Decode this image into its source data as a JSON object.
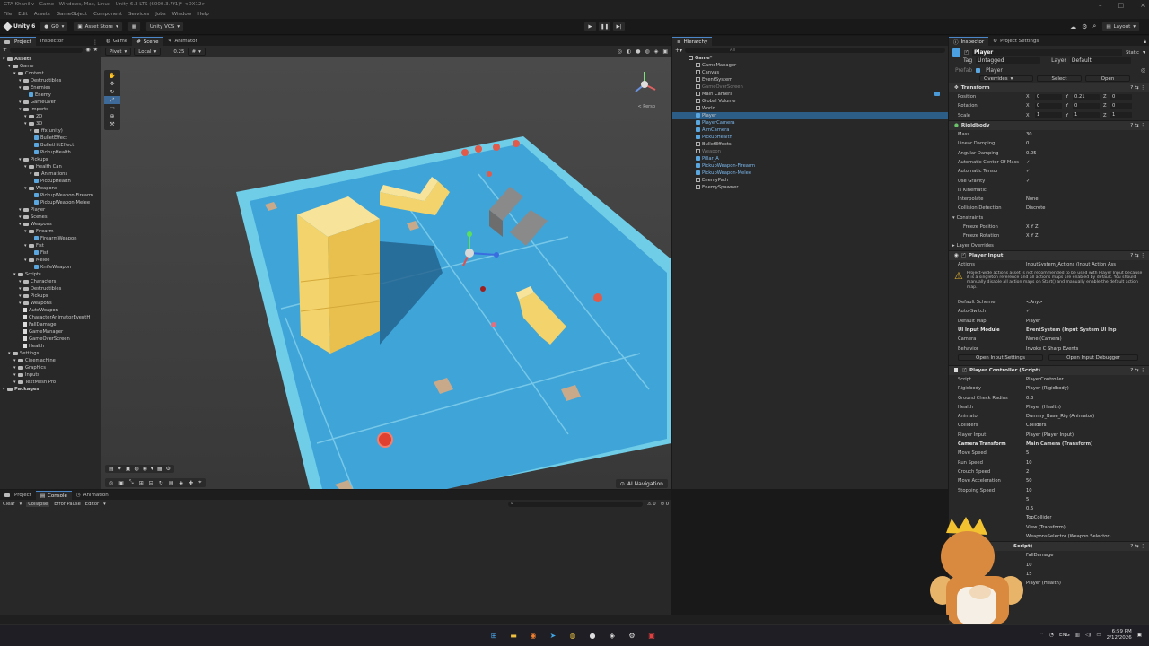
{
  "window": {
    "title": "GTA Khaniliv - Game - Windows, Mac, Linux - Unity 6.3 LTS (6000.3.7f1)* <DX12>"
  },
  "menu": [
    "File",
    "Edit",
    "Assets",
    "GameObject",
    "Component",
    "Services",
    "Jobs",
    "Window",
    "Help"
  ],
  "toolbar": {
    "unity_label": "Unity 6",
    "asset_store": "Asset Store",
    "vcs": "Unity VCS",
    "layout": "Layout",
    "account": "GO"
  },
  "left_tabs": {
    "project": "Project",
    "inspector": "Inspector"
  },
  "project_tree": [
    {
      "t": "Assets",
      "d": 0,
      "k": "folder"
    },
    {
      "t": "Game",
      "d": 1,
      "k": "folder"
    },
    {
      "t": "Content",
      "d": 2,
      "k": "folder"
    },
    {
      "t": "Destructibles",
      "d": 3,
      "k": "folder"
    },
    {
      "t": "Enemies",
      "d": 3,
      "k": "folder"
    },
    {
      "t": "Enemy",
      "d": 4,
      "k": "prefab"
    },
    {
      "t": "GameOver",
      "d": 3,
      "k": "folder"
    },
    {
      "t": "Imports",
      "d": 3,
      "k": "folder"
    },
    {
      "t": "2D",
      "d": 4,
      "k": "folder"
    },
    {
      "t": "3D",
      "d": 4,
      "k": "folder"
    },
    {
      "t": "ffx(unity)",
      "d": 5,
      "k": "folder"
    },
    {
      "t": "BulletEffect",
      "d": 5,
      "k": "prefab"
    },
    {
      "t": "BulletHitEffect",
      "d": 5,
      "k": "prefab"
    },
    {
      "t": "PickupHealth",
      "d": 5,
      "k": "prefab"
    },
    {
      "t": "Pickups",
      "d": 3,
      "k": "folder"
    },
    {
      "t": "Health Can",
      "d": 4,
      "k": "folder"
    },
    {
      "t": "Animations",
      "d": 5,
      "k": "folder"
    },
    {
      "t": "PickupHealth",
      "d": 5,
      "k": "prefab"
    },
    {
      "t": "Weapons",
      "d": 4,
      "k": "folder"
    },
    {
      "t": "PickupWeapon-Firearm",
      "d": 5,
      "k": "prefab"
    },
    {
      "t": "PickupWeapon-Melee",
      "d": 5,
      "k": "prefab"
    },
    {
      "t": "Player",
      "d": 3,
      "k": "folder"
    },
    {
      "t": "Scenes",
      "d": 3,
      "k": "folder"
    },
    {
      "t": "Weapons",
      "d": 3,
      "k": "folder"
    },
    {
      "t": "Firearm",
      "d": 4,
      "k": "folder"
    },
    {
      "t": "FirearmWeapon",
      "d": 5,
      "k": "prefab"
    },
    {
      "t": "Fist",
      "d": 4,
      "k": "folder"
    },
    {
      "t": "Fist",
      "d": 5,
      "k": "prefab"
    },
    {
      "t": "Melee",
      "d": 4,
      "k": "folder"
    },
    {
      "t": "KnifeWeapon",
      "d": 5,
      "k": "prefab"
    },
    {
      "t": "Scripts",
      "d": 2,
      "k": "folder"
    },
    {
      "t": "Characters",
      "d": 3,
      "k": "folder"
    },
    {
      "t": "Destructibles",
      "d": 3,
      "k": "folder"
    },
    {
      "t": "Pickups",
      "d": 3,
      "k": "folder"
    },
    {
      "t": "Weapons",
      "d": 3,
      "k": "folder"
    },
    {
      "t": "AutoWeapon",
      "d": 3,
      "k": "script"
    },
    {
      "t": "CharacterAnimatorEventH",
      "d": 3,
      "k": "script"
    },
    {
      "t": "FallDamage",
      "d": 3,
      "k": "script"
    },
    {
      "t": "GameManager",
      "d": 3,
      "k": "script"
    },
    {
      "t": "GameOverScreen",
      "d": 3,
      "k": "script"
    },
    {
      "t": "Health",
      "d": 3,
      "k": "script"
    },
    {
      "t": "Settings",
      "d": 1,
      "k": "folder"
    },
    {
      "t": "Cinemachine",
      "d": 2,
      "k": "folder"
    },
    {
      "t": "Graphics",
      "d": 2,
      "k": "folder"
    },
    {
      "t": "Inputs",
      "d": 2,
      "k": "folder"
    },
    {
      "t": "TextMesh Pro",
      "d": 2,
      "k": "folder"
    },
    {
      "t": "Packages",
      "d": 0,
      "k": "folder"
    }
  ],
  "scene_tabs": {
    "game": "Game",
    "scene": "Scene",
    "animator": "Animator"
  },
  "scene_toolbar": {
    "pivot": "Pivot",
    "local": "Local",
    "snap": "0.25"
  },
  "scene": {
    "persp": "< Persp",
    "ai_nav": "AI Navigation"
  },
  "hierarchy": {
    "tab": "Hierarchy",
    "search_placeholder": "All",
    "items": [
      {
        "t": "Game*",
        "d": 0,
        "k": "scene"
      },
      {
        "t": "GameManager",
        "d": 1,
        "k": "cube"
      },
      {
        "t": "Canvas",
        "d": 1,
        "k": "cube"
      },
      {
        "t": "EventSystem",
        "d": 1,
        "k": "cube"
      },
      {
        "t": "GameOverScreen",
        "d": 1,
        "k": "dim"
      },
      {
        "t": "Main Camera",
        "d": 1,
        "k": "cube"
      },
      {
        "t": "Global Volume",
        "d": 1,
        "k": "cube"
      },
      {
        "t": "World",
        "d": 1,
        "k": "cube"
      },
      {
        "t": "Player",
        "d": 1,
        "k": "sel"
      },
      {
        "t": "PlayerCamera",
        "d": 1,
        "k": "prefab"
      },
      {
        "t": "AimCamera",
        "d": 1,
        "k": "prefab"
      },
      {
        "t": "PickupHealth",
        "d": 1,
        "k": "prefab"
      },
      {
        "t": "BulletEffects",
        "d": 1,
        "k": "cube"
      },
      {
        "t": "Weapon",
        "d": 1,
        "k": "dim"
      },
      {
        "t": "Pillar_A",
        "d": 1,
        "k": "prefab"
      },
      {
        "t": "PickupWeapon-Firearm",
        "d": 1,
        "k": "prefab"
      },
      {
        "t": "PickupWeapon-Melee",
        "d": 1,
        "k": "prefab"
      },
      {
        "t": "EnemyPath",
        "d": 1,
        "k": "cube"
      },
      {
        "t": "EnemySpawner",
        "d": 1,
        "k": "cube"
      }
    ]
  },
  "inspector": {
    "tab": "Inspector",
    "tab2": "Project Settings",
    "object_name": "Player",
    "static_label": "Static",
    "tag_label": "Tag",
    "tag_value": "Untagged",
    "layer_label": "Layer",
    "layer_value": "Default",
    "prefab_label": "Prefab",
    "prefab_value": "Player",
    "overrides": "Overrides",
    "select": "Select",
    "open": "Open",
    "transform": {
      "title": "Transform",
      "position": {
        "label": "Position",
        "x": "0",
        "y": "0.21",
        "z": "0"
      },
      "rotation": {
        "label": "Rotation",
        "x": "0",
        "y": "0",
        "z": "0"
      },
      "scale": {
        "label": "Scale",
        "x": "1",
        "y": "1",
        "z": "1"
      }
    },
    "rigidbody": {
      "title": "Rigidbody",
      "rows": [
        {
          "l": "Mass",
          "v": "30"
        },
        {
          "l": "Linear Damping",
          "v": "0"
        },
        {
          "l": "Angular Damping",
          "v": "0.05"
        },
        {
          "l": "Automatic Center Of Mass",
          "v": "✓"
        },
        {
          "l": "Automatic Tensor",
          "v": "✓"
        },
        {
          "l": "Use Gravity",
          "v": "✓"
        },
        {
          "l": "Is Kinematic",
          "v": ""
        },
        {
          "l": "Interpolate",
          "v": "None"
        },
        {
          "l": "Collision Detection",
          "v": "Discrete"
        }
      ],
      "constraints": "Constraints",
      "freeze_pos": "Freeze Position",
      "freeze_rot": "Freeze Rotation",
      "xyz": "X  Y  Z",
      "layer_overrides": "Layer Overrides"
    },
    "player_input": {
      "title": "Player Input",
      "actions_label": "Actions",
      "actions_value": "InputSystem_Actions (Input Action Ass",
      "warning": "Project-wide actions asset is not recommended to be used with Player Input because it is a singleton reference and all actions maps are enabled by default. You should manually disable all action maps on Start() and manually enable the default action map.",
      "rows": [
        {
          "l": "Default Scheme",
          "v": "<Any>"
        },
        {
          "l": "Auto-Switch",
          "v": "✓"
        },
        {
          "l": "Default Map",
          "v": "Player"
        },
        {
          "l": "UI Input Module",
          "v": "EventSystem (Input System UI Inp"
        },
        {
          "l": "Camera",
          "v": "None (Camera)"
        },
        {
          "l": "Behavior",
          "v": "Invoke C Sharp Events"
        }
      ],
      "btn_settings": "Open Input Settings",
      "btn_debugger": "Open Input Debugger"
    },
    "player_controller": {
      "title": "Player Controller (Script)",
      "rows": [
        {
          "l": "Script",
          "v": "PlayerController"
        },
        {
          "l": "Rigidbody",
          "v": "Player (Rigidbody)"
        },
        {
          "l": "Ground Check Radius",
          "v": "0.3"
        },
        {
          "l": "Health",
          "v": "Player (Health)"
        },
        {
          "l": "Animator",
          "v": "Dummy_Base_Rig (Animator)"
        },
        {
          "l": "Colliders",
          "v": "Colliders"
        },
        {
          "l": "Player Input",
          "v": "Player (Player Input)"
        },
        {
          "l": "Camera Transform",
          "v": "Main Camera (Transform)"
        },
        {
          "l": "Move Speed",
          "v": "5"
        },
        {
          "l": "Run Speed",
          "v": "10"
        },
        {
          "l": "Crouch Speed",
          "v": "2"
        },
        {
          "l": "Move Acceleration",
          "v": "50"
        },
        {
          "l": "Stopping Speed",
          "v": "10"
        },
        {
          "l": "",
          "v": "5"
        },
        {
          "l": "",
          "v": "0.5"
        },
        {
          "l": "",
          "v": "TopCollider"
        },
        {
          "l": "",
          "v": "View (Transform)"
        },
        {
          "l": "",
          "v": "WeaponsSelector (Weapon Selector)"
        }
      ]
    },
    "fall_damage": {
      "title": "Script)",
      "rows": [
        {
          "l": "",
          "v": "FallDamage"
        },
        {
          "l": "",
          "v": "10"
        },
        {
          "l": "",
          "v": "15"
        },
        {
          "l": "",
          "v": "Player (Health)"
        }
      ]
    }
  },
  "bottom_tabs": {
    "project": "Project",
    "console": "Console",
    "animation": "Animation"
  },
  "console_toolbar": {
    "clear": "Clear",
    "collapse": "Collapse",
    "error_pause": "Error Pause",
    "editor": "Editor",
    "count_warn": "0",
    "count_err": "0"
  },
  "taskbar": {
    "lang": "ENG",
    "time": "6:59 PM",
    "date": "2/12/2026"
  },
  "colors": {
    "accent": "#4a86c8",
    "floor": "#3fa4d8",
    "floor_edge": "#6fcde8",
    "block": "#f3d36b",
    "selection": "#2c5d87"
  }
}
